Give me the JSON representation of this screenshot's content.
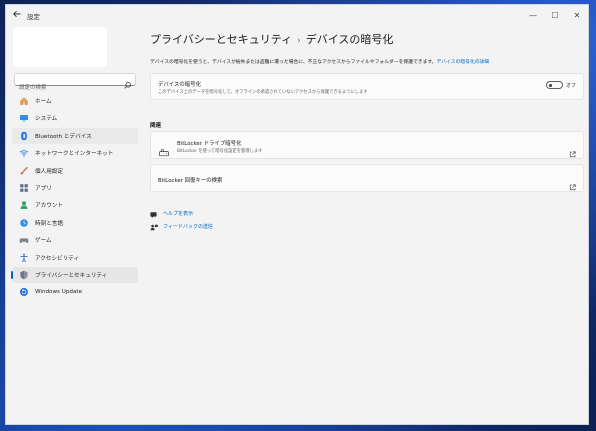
{
  "window": {
    "title": "設定",
    "back_icon": "back-arrow-icon",
    "controls": {
      "minimize": "—",
      "maximize": "☐",
      "close": "✕"
    }
  },
  "search": {
    "placeholder": "設定の検索",
    "value": ""
  },
  "sidebar": {
    "items": [
      {
        "label": "ホーム",
        "icon": "home-icon"
      },
      {
        "label": "システム",
        "icon": "system-icon"
      },
      {
        "label": "Bluetooth とデバイス",
        "icon": "bluetooth-icon"
      },
      {
        "label": "ネットワークとインターネット",
        "icon": "network-icon"
      },
      {
        "label": "個人用設定",
        "icon": "brush-icon"
      },
      {
        "label": "アプリ",
        "icon": "apps-icon"
      },
      {
        "label": "アカウント",
        "icon": "account-icon"
      },
      {
        "label": "時刻と言語",
        "icon": "clock-globe-icon"
      },
      {
        "label": "ゲーム",
        "icon": "gamepad-icon"
      },
      {
        "label": "アクセシビリティ",
        "icon": "accessibility-icon"
      },
      {
        "label": "プライバシーとセキュリティ",
        "icon": "shield-icon"
      },
      {
        "label": "Windows Update",
        "icon": "update-icon"
      }
    ]
  },
  "breadcrumb": {
    "parent": "プライバシーとセキュリティ",
    "separator": "›",
    "current": "デバイスの暗号化"
  },
  "description": {
    "text": "デバイスの暗号化を使うと、デバイスが紛失または盗難に遭った場合に、不正なアクセスからファイルやフォルダーを保護できます。",
    "link": "デバイスの暗号化の詳細"
  },
  "encryption_card": {
    "title": "デバイスの暗号化",
    "subtitle": "このデバイス上のデータを暗号化して、オフラインの承認されていないアクセスから保護できるようにします",
    "toggle_state": "オフ"
  },
  "related": {
    "heading": "関連",
    "bitlocker": {
      "title": "BitLocker ドライブ暗号化",
      "subtitle": "BitLocker を使って暗号化設定を管理します"
    },
    "recovery": {
      "title": "BitLocker 回復キーの検索"
    }
  },
  "help_links": {
    "help": "ヘルプを表示",
    "feedback": "フィードバックの送信"
  },
  "colors": {
    "accent": "#0067c0",
    "window_bg": "#f3f3f3",
    "card_bg": "#fbfbfb"
  }
}
